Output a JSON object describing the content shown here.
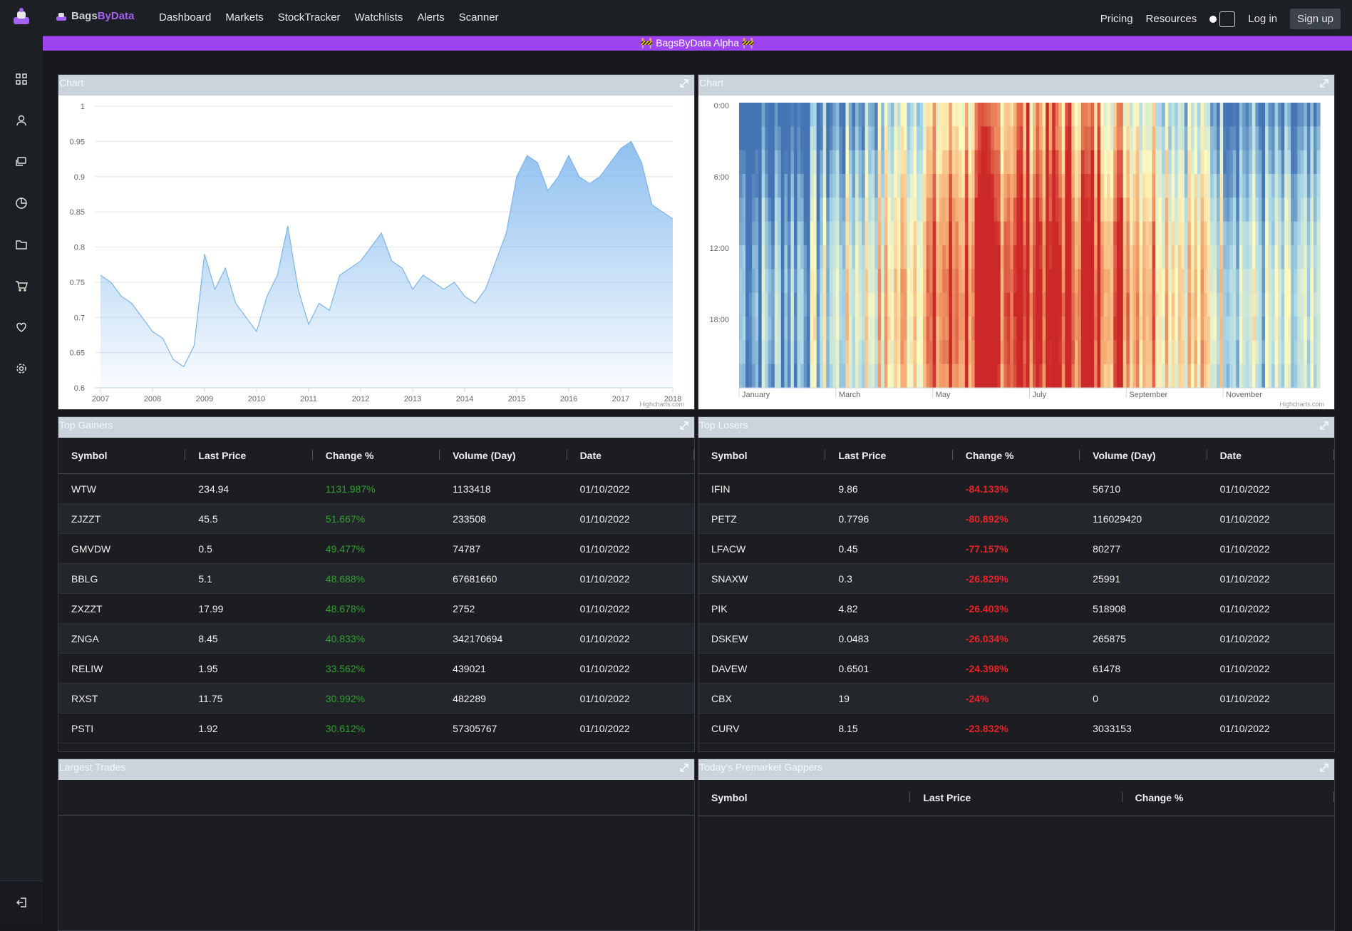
{
  "brand": {
    "part1": "Bags",
    "part2": "ByData"
  },
  "nav": [
    "Dashboard",
    "Markets",
    "StockTracker",
    "Watchlists",
    "Alerts",
    "Scanner"
  ],
  "right_nav": {
    "pricing": "Pricing",
    "resources": "Resources",
    "login": "Log in",
    "signup": "Sign up"
  },
  "banner": "🚧 BagsByData Alpha 🚧",
  "sidebar_icons": [
    "grid-icon",
    "user-icon",
    "chat-icon",
    "pie-chart-icon",
    "folder-icon",
    "cart-icon",
    "heart-icon",
    "gear-icon"
  ],
  "panels": {
    "chart1_title": "Chart",
    "chart2_title": "Chart",
    "gainers_title": "Top Gainers",
    "losers_title": "Top Losers",
    "trades_title": "Largest Trades",
    "gappers_title": "Today's Premarket Gappers"
  },
  "credit": "Highcharts.com",
  "table_headers": [
    "Symbol",
    "Last Price",
    "Change %",
    "Volume (Day)",
    "Date"
  ],
  "gappers_headers": [
    "Symbol",
    "Last Price",
    "Change %"
  ],
  "gainers": [
    {
      "symbol": "WTW",
      "price": "234.94",
      "change": "1131.987%",
      "volume": "1133418",
      "date": "01/10/2022"
    },
    {
      "symbol": "ZJZZT",
      "price": "45.5",
      "change": "51.667%",
      "volume": "233508",
      "date": "01/10/2022"
    },
    {
      "symbol": "GMVDW",
      "price": "0.5",
      "change": "49.477%",
      "volume": "74787",
      "date": "01/10/2022"
    },
    {
      "symbol": "BBLG",
      "price": "5.1",
      "change": "48.688%",
      "volume": "67681660",
      "date": "01/10/2022"
    },
    {
      "symbol": "ZXZZT",
      "price": "17.99",
      "change": "48.678%",
      "volume": "2752",
      "date": "01/10/2022"
    },
    {
      "symbol": "ZNGA",
      "price": "8.45",
      "change": "40.833%",
      "volume": "342170694",
      "date": "01/10/2022"
    },
    {
      "symbol": "RELIW",
      "price": "1.95",
      "change": "33.562%",
      "volume": "439021",
      "date": "01/10/2022"
    },
    {
      "symbol": "RXST",
      "price": "11.75",
      "change": "30.992%",
      "volume": "482289",
      "date": "01/10/2022"
    },
    {
      "symbol": "PSTI",
      "price": "1.92",
      "change": "30.612%",
      "volume": "57305767",
      "date": "01/10/2022"
    }
  ],
  "losers": [
    {
      "symbol": "IFIN",
      "price": "9.86",
      "change": "-84.133%",
      "volume": "56710",
      "date": "01/10/2022"
    },
    {
      "symbol": "PETZ",
      "price": "0.7796",
      "change": "-80.892%",
      "volume": "116029420",
      "date": "01/10/2022"
    },
    {
      "symbol": "LFACW",
      "price": "0.45",
      "change": "-77.157%",
      "volume": "80277",
      "date": "01/10/2022"
    },
    {
      "symbol": "SNAXW",
      "price": "0.3",
      "change": "-26.829%",
      "volume": "25991",
      "date": "01/10/2022"
    },
    {
      "symbol": "PIK",
      "price": "4.82",
      "change": "-26.403%",
      "volume": "518908",
      "date": "01/10/2022"
    },
    {
      "symbol": "DSKEW",
      "price": "0.0483",
      "change": "-26.034%",
      "volume": "265875",
      "date": "01/10/2022"
    },
    {
      "symbol": "DAVEW",
      "price": "0.6501",
      "change": "-24.398%",
      "volume": "61478",
      "date": "01/10/2022"
    },
    {
      "symbol": "CBX",
      "price": "19",
      "change": "-24%",
      "volume": "0",
      "date": "01/10/2022"
    },
    {
      "symbol": "CURV",
      "price": "8.15",
      "change": "-23.832%",
      "volume": "3033153",
      "date": "01/10/2022"
    }
  ],
  "chart_data": [
    {
      "type": "area",
      "x_ticks": [
        "2007",
        "2008",
        "2009",
        "2010",
        "2011",
        "2012",
        "2013",
        "2014",
        "2015",
        "2016",
        "2017",
        "2018"
      ],
      "y_ticks": [
        "0.6",
        "0.65",
        "0.7",
        "0.75",
        "0.8",
        "0.85",
        "0.9",
        "0.95",
        "1"
      ],
      "ylim": [
        0.6,
        1
      ],
      "xlim": [
        2007,
        2018
      ],
      "grid": true,
      "color": "#7cb5ec",
      "x": [
        2007.0,
        2007.2,
        2007.4,
        2007.6,
        2007.8,
        2008.0,
        2008.2,
        2008.4,
        2008.6,
        2008.8,
        2009.0,
        2009.2,
        2009.4,
        2009.6,
        2009.8,
        2010.0,
        2010.2,
        2010.4,
        2010.6,
        2010.8,
        2011.0,
        2011.2,
        2011.4,
        2011.6,
        2011.8,
        2012.0,
        2012.2,
        2012.4,
        2012.6,
        2012.8,
        2013.0,
        2013.2,
        2013.4,
        2013.6,
        2013.8,
        2014.0,
        2014.2,
        2014.4,
        2014.6,
        2014.8,
        2015.0,
        2015.2,
        2015.4,
        2015.6,
        2015.8,
        2016.0,
        2016.2,
        2016.4,
        2016.6,
        2016.8,
        2017.0,
        2017.2,
        2017.4,
        2017.6,
        2017.8,
        2018.0
      ],
      "values": [
        0.76,
        0.75,
        0.73,
        0.72,
        0.7,
        0.68,
        0.67,
        0.64,
        0.63,
        0.66,
        0.79,
        0.74,
        0.77,
        0.72,
        0.7,
        0.68,
        0.73,
        0.76,
        0.83,
        0.74,
        0.69,
        0.72,
        0.71,
        0.76,
        0.77,
        0.78,
        0.8,
        0.82,
        0.78,
        0.77,
        0.74,
        0.76,
        0.75,
        0.74,
        0.75,
        0.73,
        0.72,
        0.74,
        0.78,
        0.82,
        0.9,
        0.93,
        0.92,
        0.88,
        0.9,
        0.93,
        0.9,
        0.89,
        0.9,
        0.92,
        0.94,
        0.95,
        0.92,
        0.86,
        0.85,
        0.84
      ]
    },
    {
      "type": "heatmap",
      "x_ticks": [
        "January",
        "March",
        "May",
        "July",
        "September",
        "November"
      ],
      "y_ticks": [
        "0:00",
        "6:00",
        "12:00",
        "18:00"
      ]
    }
  ]
}
